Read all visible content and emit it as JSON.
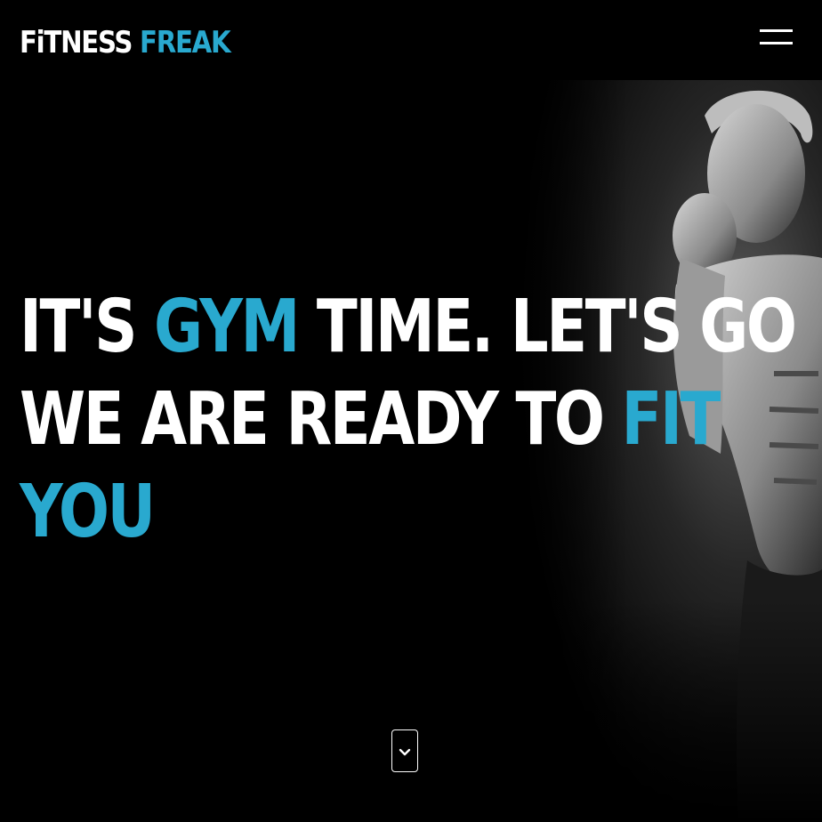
{
  "brand": {
    "part1": "FiTNESS",
    "part2": "FREAK"
  },
  "colors": {
    "accent": "#29a9cf",
    "text": "#ffffff",
    "background": "#000000"
  },
  "hero": {
    "line1_a": "IT'S",
    "line1_b": "GYM",
    "line1_c": "TIME. LET'S GO",
    "line2_a": "WE ARE READY TO",
    "line2_b": "FIT",
    "line3": "YOU"
  },
  "icons": {
    "menu": "hamburger-icon",
    "scroll": "chevron-down-icon"
  }
}
